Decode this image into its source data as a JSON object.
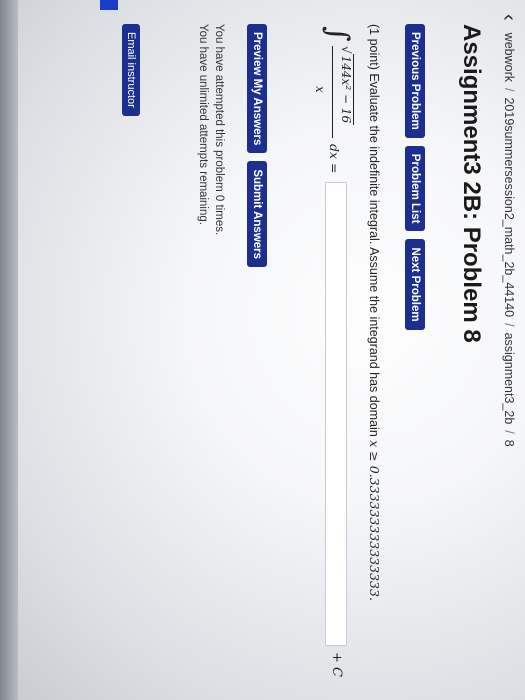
{
  "breadcrumb": {
    "items": [
      "webwork",
      "2019summersession2_math_2b_44140",
      "assignment3_2b",
      "8"
    ],
    "separator": "/"
  },
  "page_title": "Assignment3 2B: Problem 8",
  "nav_buttons": {
    "previous": "Previous Problem",
    "list": "Problem List",
    "next": "Next Problem"
  },
  "problem": {
    "points": "(1 point)",
    "text": "Evaluate the indefinite integral. Assume the integrand has domain",
    "domain_math": "x ≥ 0.333333333333333.",
    "integral_sign": "∫",
    "numerator_radical": "√",
    "numerator_expr": "144x² − 16",
    "denominator": "x",
    "dx": "dx =",
    "answer_value": "",
    "plus_c": "+ C"
  },
  "actions": {
    "preview": "Preview My Answers",
    "submit": "Submit Answers"
  },
  "status": {
    "attempts": "You have attempted this problem 0 times.",
    "remaining": "You have unlimited attempts remaining."
  },
  "email_button": "Email instructor",
  "icons": {
    "back": "chevron-left-icon"
  },
  "colors": {
    "button_bg": "#1c2f8e",
    "accent_mark": "#1b3cc7"
  }
}
